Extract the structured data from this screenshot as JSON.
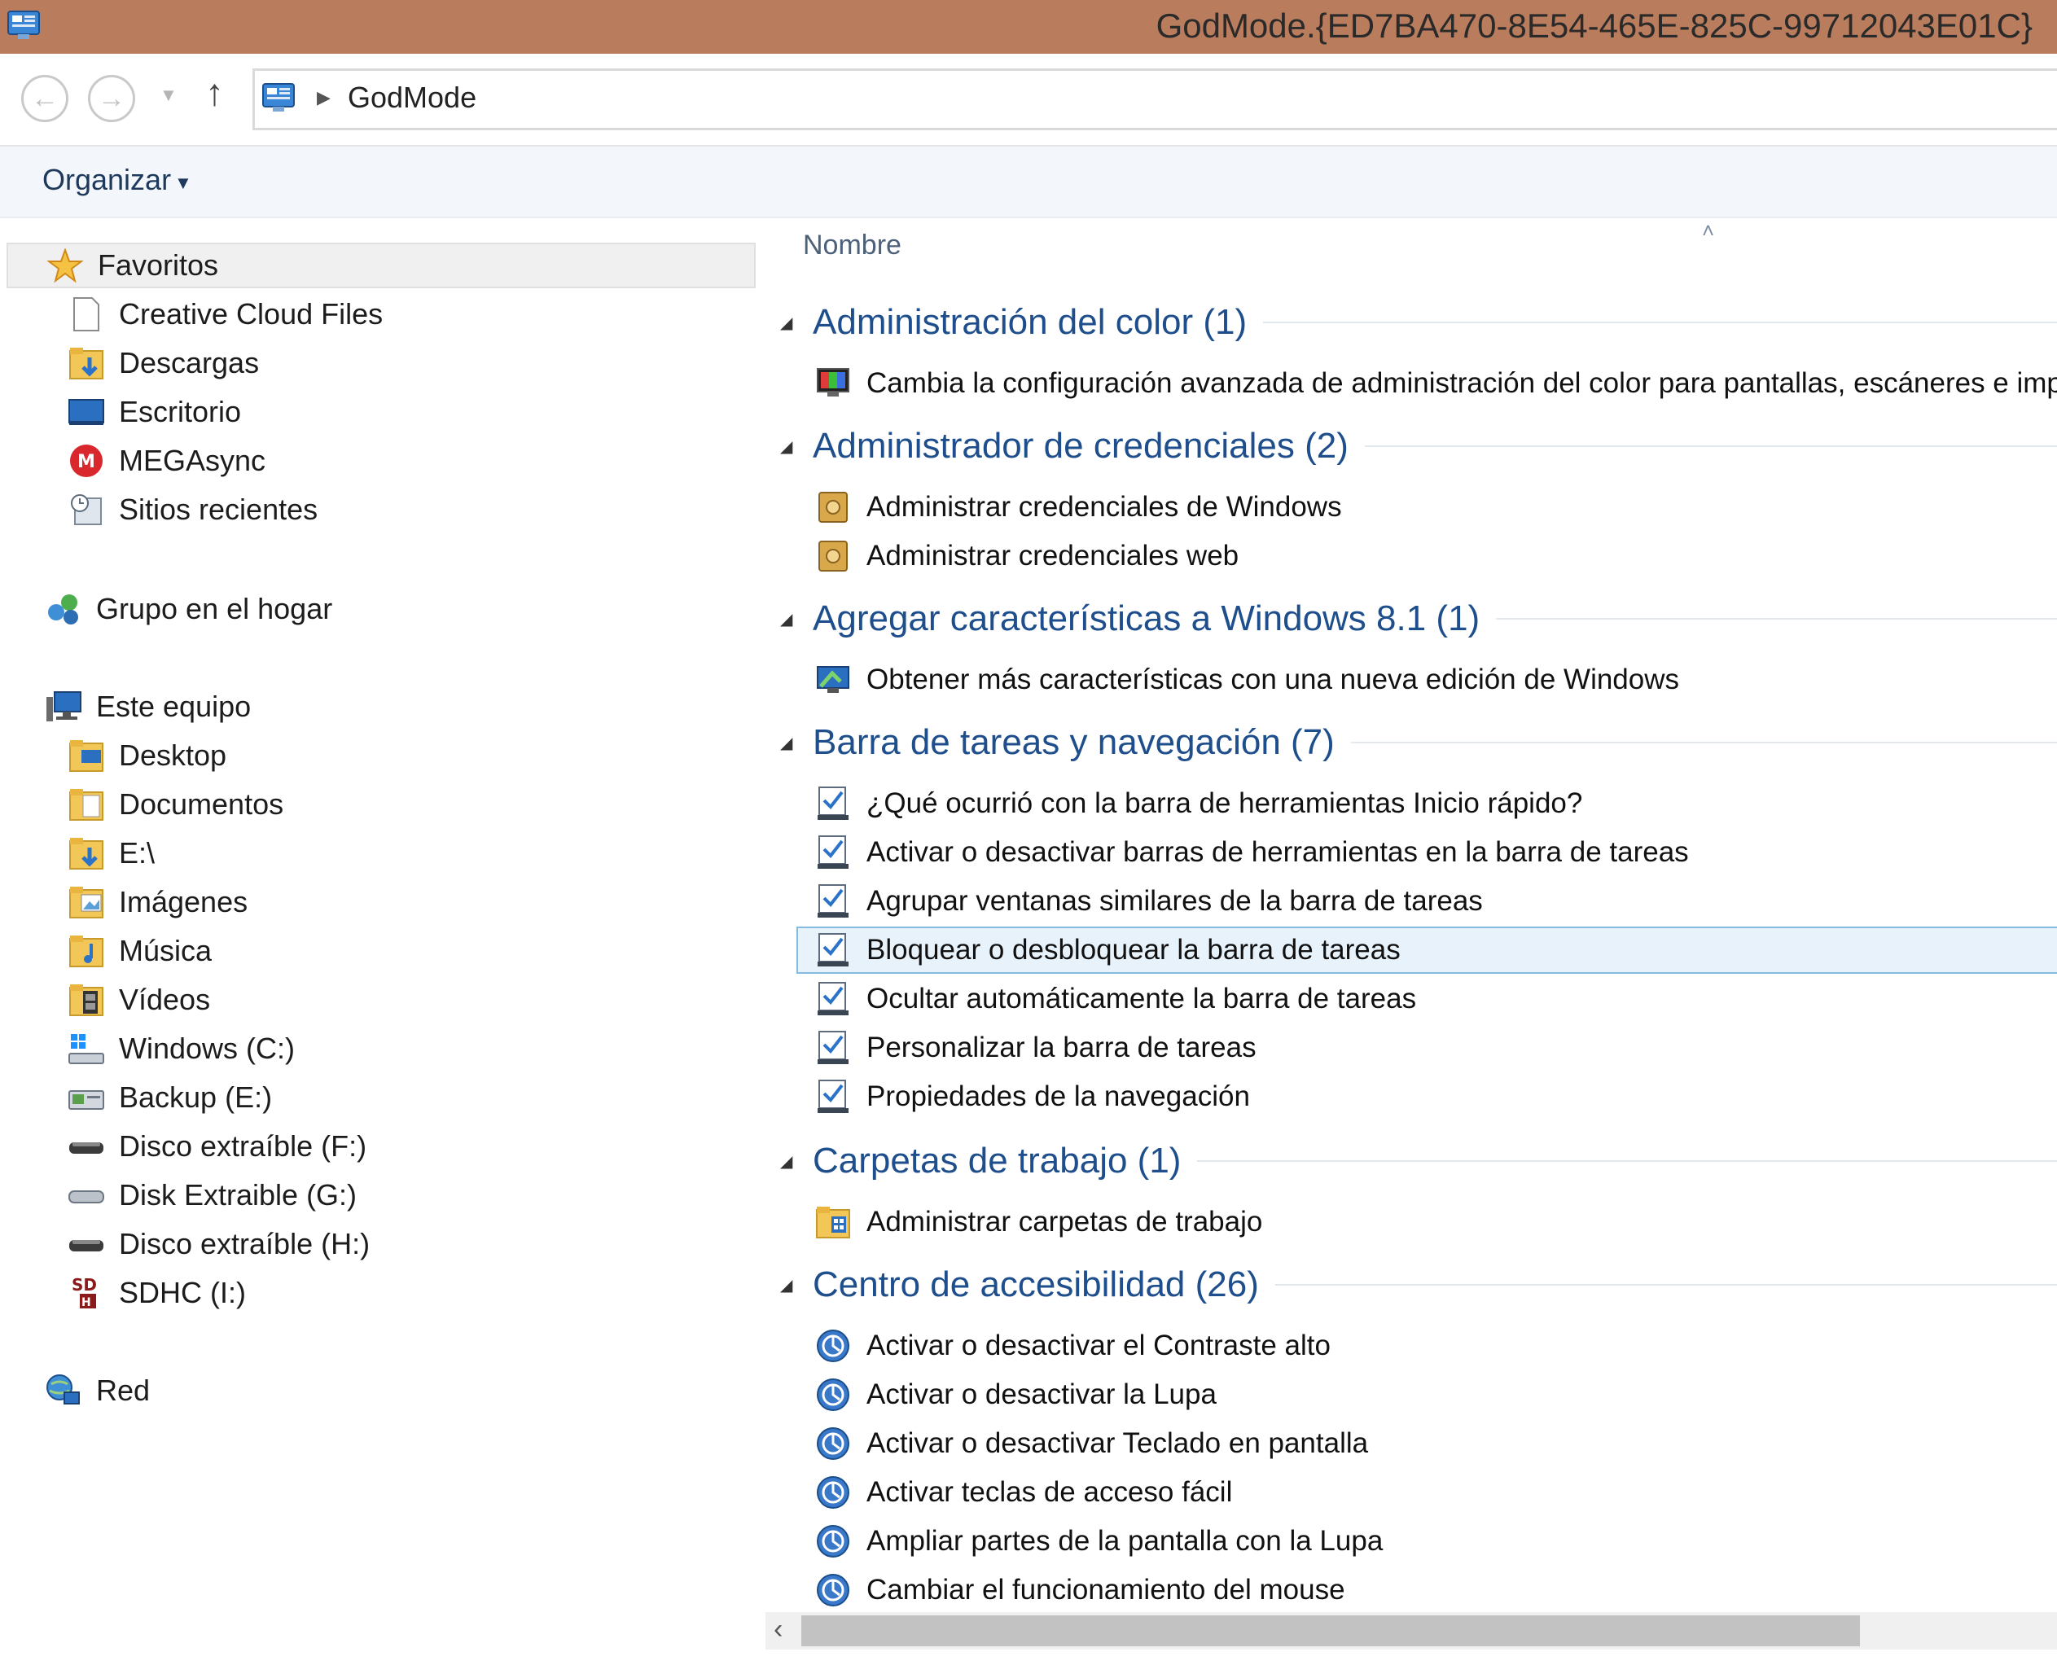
{
  "window": {
    "title": "GodMode.{ED7BA470-8E54-465E-825C-99712043E01C}"
  },
  "address_bar": {
    "back_icon": "arrow-left-icon",
    "forward_icon": "arrow-right-icon",
    "recent_icon": "chevron-down-icon",
    "up_icon": "arrow-up-icon",
    "breadcrumb": "GodMode"
  },
  "command_bar": {
    "organize_label": "Organizar"
  },
  "nav_pane": {
    "favorites": {
      "label": "Favoritos",
      "icon": "star-icon"
    },
    "favorites_items": [
      {
        "label": "Creative Cloud Files",
        "icon": "file-icon"
      },
      {
        "label": "Descargas",
        "icon": "downloads-folder-icon"
      },
      {
        "label": "Escritorio",
        "icon": "desktop-icon"
      },
      {
        "label": "MEGAsync",
        "icon": "mega-icon"
      },
      {
        "label": "Sitios recientes",
        "icon": "recent-places-icon"
      }
    ],
    "homegroup": {
      "label": "Grupo en el hogar",
      "icon": "homegroup-icon"
    },
    "this_pc": {
      "label": "Este equipo",
      "icon": "computer-icon"
    },
    "this_pc_items": [
      {
        "label": "Desktop",
        "icon": "folder-icon"
      },
      {
        "label": "Documentos",
        "icon": "documents-folder-icon"
      },
      {
        "label": "E:\\",
        "icon": "downloads-folder-icon"
      },
      {
        "label": "Imágenes",
        "icon": "pictures-folder-icon"
      },
      {
        "label": "Música",
        "icon": "music-folder-icon"
      },
      {
        "label": "Vídeos",
        "icon": "videos-folder-icon"
      },
      {
        "label": "Windows (C:)",
        "icon": "windows-drive-icon"
      },
      {
        "label": "Backup (E:)",
        "icon": "network-drive-icon"
      },
      {
        "label": "Disco extraíble (F:)",
        "icon": "removable-drive-icon"
      },
      {
        "label": "Disk Extraible (G:)",
        "icon": "removable-drive-icon"
      },
      {
        "label": "Disco extraíble (H:)",
        "icon": "removable-drive-icon"
      },
      {
        "label": "SDHC (I:)",
        "icon": "sd-card-icon"
      }
    ],
    "network": {
      "label": "Red",
      "icon": "network-icon"
    }
  },
  "content": {
    "column_header": "Nombre",
    "groups": [
      {
        "title": "Administración del color (1)",
        "icon": "color-management-icon",
        "items": [
          "Cambia la configuración avanzada de administración del color para pantallas, escáneres e impreso"
        ]
      },
      {
        "title": "Administrador de credenciales (2)",
        "icon": "credential-vault-icon",
        "items": [
          "Administrar credenciales de Windows",
          "Administrar credenciales web"
        ]
      },
      {
        "title": "Agregar características a Windows 8.1 (1)",
        "icon": "add-features-icon",
        "items": [
          "Obtener más características con una nueva edición de Windows"
        ]
      },
      {
        "title": "Barra de tareas y navegación (7)",
        "icon": "taskbar-checklist-icon",
        "items": [
          "¿Qué ocurrió con la barra de herramientas Inicio rápido?",
          "Activar o desactivar barras de herramientas en la barra de tareas",
          "Agrupar ventanas similares de la barra de tareas",
          "Bloquear o desbloquear la barra de tareas",
          "Ocultar automáticamente la barra de tareas",
          "Personalizar la barra de tareas",
          "Propiedades de la navegación"
        ],
        "selected_index": 3
      },
      {
        "title": "Carpetas de trabajo (1)",
        "icon": "work-folders-icon",
        "items": [
          "Administrar carpetas de trabajo"
        ]
      },
      {
        "title": "Centro de accesibilidad (26)",
        "icon": "ease-of-access-icon",
        "items": [
          "Activar o desactivar el Contraste alto",
          "Activar o desactivar la Lupa",
          "Activar o desactivar Teclado en pantalla",
          "Activar teclas de acceso fácil",
          "Ampliar partes de la pantalla con la Lupa",
          "Cambiar el funcionamiento del mouse"
        ]
      }
    ]
  },
  "colors": {
    "titlebar": "#b97c5d",
    "group_title": "#1e4e8c",
    "selection_bg": "#e8f2fb",
    "selection_border": "#86bbe0"
  }
}
